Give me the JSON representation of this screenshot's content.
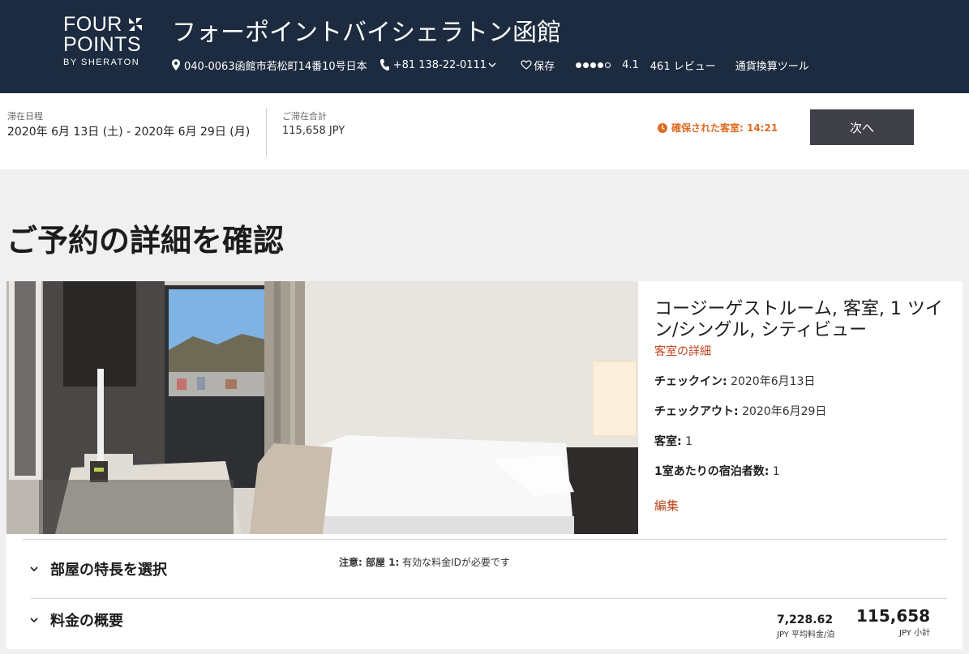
{
  "header": {
    "logo": {
      "line1": "FOUR",
      "line2": "POINTS",
      "line3": "BY SHERATON"
    },
    "hotel_name": "フォーポイントバイシェラトン函館",
    "address": "040-0063函館市若松町14番10号日本",
    "phone": "+81 138-22-0111",
    "save_label": "保存",
    "rating_value": "4.1",
    "rating_filled": 4,
    "rating_total": 5,
    "reviews": "461 レビュー",
    "currency_tool": "通貨換算ツール"
  },
  "stay": {
    "dates_label": "滞在日程",
    "dates_value": "2020年 6月 13日 (土) - 2020年 6月 29日 (月)",
    "total_label": "ご滞在合計",
    "total_value": "115,658 JPY",
    "timer_text": "確保された客室: 14:21",
    "next_label": "次へ"
  },
  "main": {
    "title": "ご予約の詳細を確認",
    "room": {
      "title": "コージーゲストルーム, 客室, 1 ツイン/シングル, シティビュー",
      "details_link": "客室の詳細",
      "checkin_label": "チェックイン:",
      "checkin_value": "2020年6月13日",
      "checkout_label": "チェックアウト:",
      "checkout_value": "2020年6月29日",
      "rooms_label": "客室:",
      "rooms_value": "1",
      "guests_label": "1室あたりの宿泊者数:",
      "guests_value": "1",
      "edit_link": "編集"
    },
    "features_label": "部屋の特長を選択",
    "note_prefix": "注意: 部屋 1:",
    "note_text": " 有効な料金IDが必要です",
    "rate_summary_label": "料金の概要",
    "avg_rate_value": "7,228.62",
    "avg_rate_label": "JPY 平均料金/泊",
    "subtotal_value": "115,658",
    "subtotal_label": "JPY 小計"
  },
  "colors": {
    "header_bg": "#1c2b3f",
    "accent": "#c0441f",
    "timer": "#e06b1f",
    "button": "#404048"
  }
}
